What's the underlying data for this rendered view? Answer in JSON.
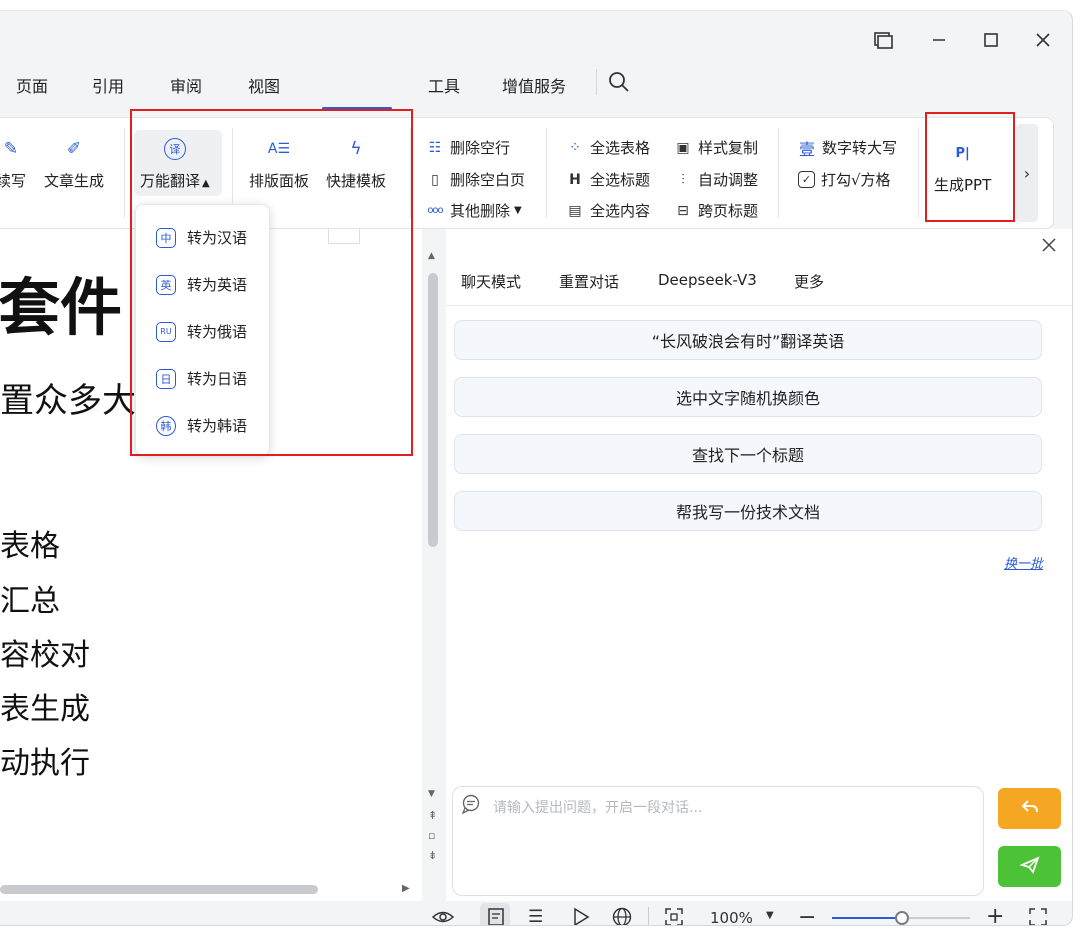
{
  "window": {
    "restore_icon": "restore-window-icon",
    "minimize_icon": "minimize-icon",
    "maximize_icon": "maximize-icon",
    "close_icon": "close-icon"
  },
  "menu": {
    "items": [
      "页面",
      "引用",
      "审阅",
      "视图",
      "工具",
      "增值服务"
    ],
    "search_icon": "search-icon"
  },
  "ribbon": {
    "continue_write": "续写",
    "article_gen": "文章生成",
    "translate": "万能翻译",
    "layout_panel": "排版面板",
    "quick_template": "快捷模板",
    "delete_empty_lines": "删除空行",
    "delete_blank_pages": "删除空白页",
    "other_delete": "其他删除",
    "select_all_tables": "全选表格",
    "select_all_headings": "全选标题",
    "select_all_content": "全选内容",
    "style_copy": "样式复制",
    "auto_adjust": "自动调整",
    "cross_page_heading": "跨页标题",
    "number_to_upper": "数字转大写",
    "check_to_box": "打勾√方格",
    "generate_ppt": "生成PPT",
    "translate_icon_glyph": "译",
    "number_icon_glyph": "壹"
  },
  "dropdown": {
    "items": [
      {
        "icon": "中",
        "label": "转为汉语"
      },
      {
        "icon": "英",
        "label": "转为英语"
      },
      {
        "icon": "RU",
        "label": "转为俄语"
      },
      {
        "icon": "日",
        "label": "转为日语"
      },
      {
        "icon": "韩",
        "label": "转为韩语"
      }
    ]
  },
  "document": {
    "title": "套件",
    "subtitle": "置众多大",
    "lines": [
      "表格",
      "汇总",
      "容校对",
      "表生成",
      "动执行"
    ]
  },
  "panel": {
    "tabs": [
      "聊天模式",
      "重置对话",
      "Deepseek-V3",
      "更多"
    ],
    "suggestions": [
      "“长风破浪会有时”翻译英语",
      "选中文字随机换颜色",
      "查找下一个标题",
      "帮我写一份技术文档"
    ],
    "refresh_link": "换一批",
    "input_placeholder": "请输入提出问题，开启一段对话...",
    "reply_button_color": "#f5a623",
    "send_button_color": "#4cc236"
  },
  "statusbar": {
    "zoom": "100%",
    "zoom_level": 0.5
  },
  "colors": {
    "accent": "#2a5bd7",
    "highlight_border": "#e02020"
  }
}
